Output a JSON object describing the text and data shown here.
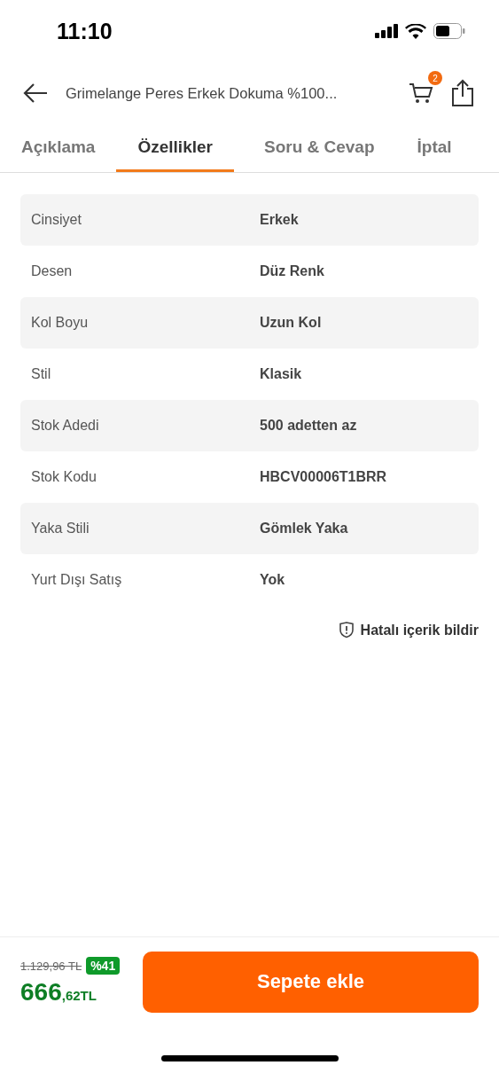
{
  "status_bar": {
    "time": "11:10"
  },
  "header": {
    "title": "Grimelange Peres Erkek Dokuma %100...",
    "cart_count": "2"
  },
  "tabs": [
    {
      "label": "Açıklama",
      "selected": false
    },
    {
      "label": "Özellikler",
      "selected": true
    },
    {
      "label": "Soru & Cevap",
      "selected": false
    },
    {
      "label": "İptal",
      "selected": false
    }
  ],
  "properties": [
    {
      "name": "Cinsiyet",
      "value": "Erkek"
    },
    {
      "name": "Desen",
      "value": "Düz Renk"
    },
    {
      "name": "Kol Boyu",
      "value": "Uzun Kol"
    },
    {
      "name": "Stil",
      "value": "Klasik"
    },
    {
      "name": "Stok Adedi",
      "value": "500 adetten az"
    },
    {
      "name": "Stok Kodu",
      "value": "HBCV00006T1BRR"
    },
    {
      "name": "Yaka Stili",
      "value": "Gömlek Yaka"
    },
    {
      "name": "Yurt Dışı Satış",
      "value": "Yok"
    }
  ],
  "report_link": "Hatalı içerik bildir",
  "footer": {
    "old_price": "1.129,96 TL",
    "discount": "%41",
    "price_main": "666",
    "price_fraction": ",62TL",
    "add_to_cart": "Sepete ekle"
  }
}
